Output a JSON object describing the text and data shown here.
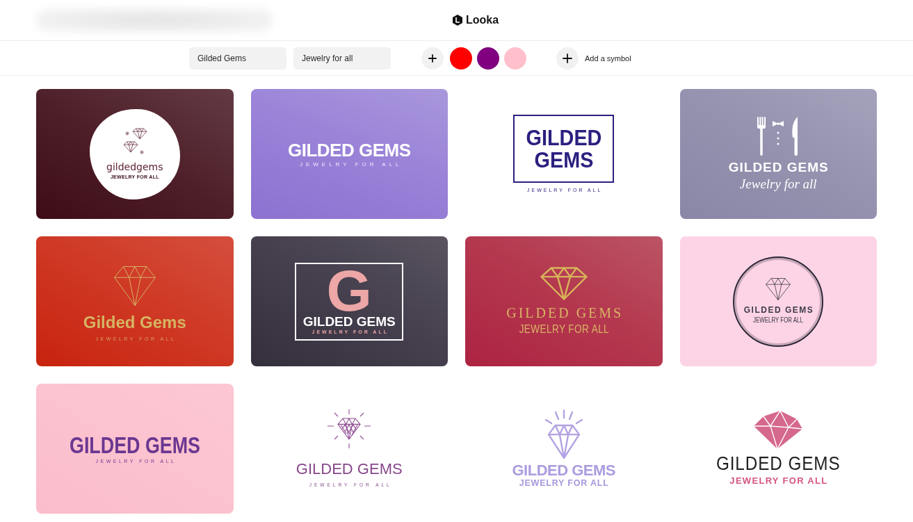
{
  "header": {
    "brand": "Looka"
  },
  "toolbar": {
    "fields": [
      {
        "value": "Gilded Gems"
      },
      {
        "value": "Jewelry for all"
      }
    ],
    "colors": [
      {
        "color": "#ff0000"
      },
      {
        "color": "#800080"
      },
      {
        "color": "#ffc0cb"
      }
    ],
    "symbol_button": {
      "label": "Add a symbol"
    }
  },
  "logos": [
    {
      "kind": "badge",
      "name": "gildedgems",
      "tagline": "JEWELRY FOR ALL"
    },
    {
      "kind": "wordmark",
      "name": "GILDED GEMS",
      "tagline": "JEWELRY FOR ALL"
    },
    {
      "kind": "framed",
      "name": "GILDED GEMS",
      "tagline": "JEWELRY FOR ALL"
    },
    {
      "kind": "dining",
      "name": "GILDED GEMS",
      "tagline": "Jewelry for all"
    },
    {
      "kind": "faceted",
      "name": "Gilded Gems",
      "tagline": "JEWELRY FOR ALL"
    },
    {
      "kind": "monogram",
      "monogram": "G",
      "name": "GILDED GEMS",
      "tagline": "JEWELRY FOR ALL"
    },
    {
      "kind": "gilded",
      "name": "GILDED GEMS",
      "tagline": "JEWELRY FOR ALL"
    },
    {
      "kind": "ring",
      "name": "GILDED GEMS",
      "tagline": "JEWELRY FOR ALL"
    },
    {
      "kind": "condensed",
      "name": "GILDED GEMS",
      "tagline": "JEWELRY FOR ALL"
    },
    {
      "kind": "radiant",
      "name": "GILDED GEMS",
      "tagline": "JEWELRY FOR ALL"
    },
    {
      "kind": "beaming",
      "name": "GILDED GEMS",
      "tagline": "JEWELRY FOR ALL"
    },
    {
      "kind": "gemstone",
      "name": "GILDED GEMS",
      "tagline": "JEWELRY FOR ALL"
    }
  ]
}
